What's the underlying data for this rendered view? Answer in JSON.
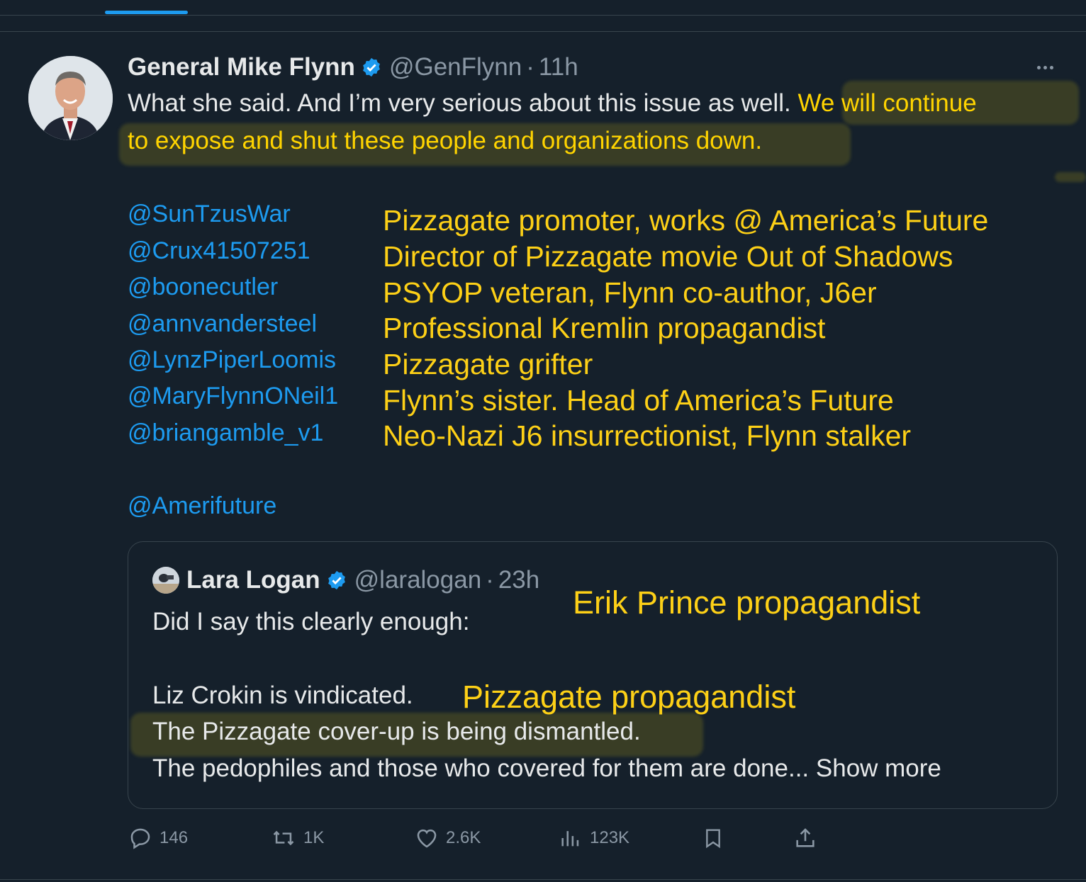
{
  "tweet": {
    "display_name": "General Mike Flynn",
    "handle": "@GenFlynn",
    "separator": "·",
    "time": "11h",
    "text_line1_plain": "What she said. And I’m very serious about this issue as well. ",
    "text_line1_highlight": "We will continue",
    "text_line2_highlight": "to expose and shut these people and organizations down.",
    "mentions": [
      "@SunTzusWar",
      "@Crux41507251",
      "@boonecutler",
      "@annvandersteel",
      "@LynzPiperLoomis",
      "@MaryFlynnONeil1",
      "@briangamble_v1"
    ],
    "final_mention": "@Amerifuture"
  },
  "annotations": [
    "Pizzagate promoter, works @ America’s Future",
    "Director of Pizzagate movie Out of Shadows",
    "PSYOP veteran, Flynn co-author, J6er",
    "Professional Kremlin propagandist",
    "Pizzagate grifter",
    "Flynn’s sister. Head of America’s Future",
    "Neo-Nazi J6 insurrectionist, Flynn stalker"
  ],
  "quote": {
    "display_name": "Lara Logan",
    "handle": "@laralogan",
    "separator": "·",
    "time": "23h",
    "line1": "Did I say this clearly enough:",
    "line2": "Liz Crokin is vindicated.",
    "line3_highlight": "The Pizzagate cover-up is being dismantled.",
    "line4": "The pedophiles and those who covered for them are done...",
    "show_more": " Show more",
    "annotation_author": "Erik Prince propagandist",
    "annotation_crokin": "Pizzagate propagandist"
  },
  "actions": {
    "replies": "146",
    "reposts": "1K",
    "likes": "2.6K",
    "views": "123K"
  },
  "colors": {
    "background": "#15202b",
    "link": "#1d9bf0",
    "annotation": "#fdd017",
    "muted": "#8b98a5"
  }
}
